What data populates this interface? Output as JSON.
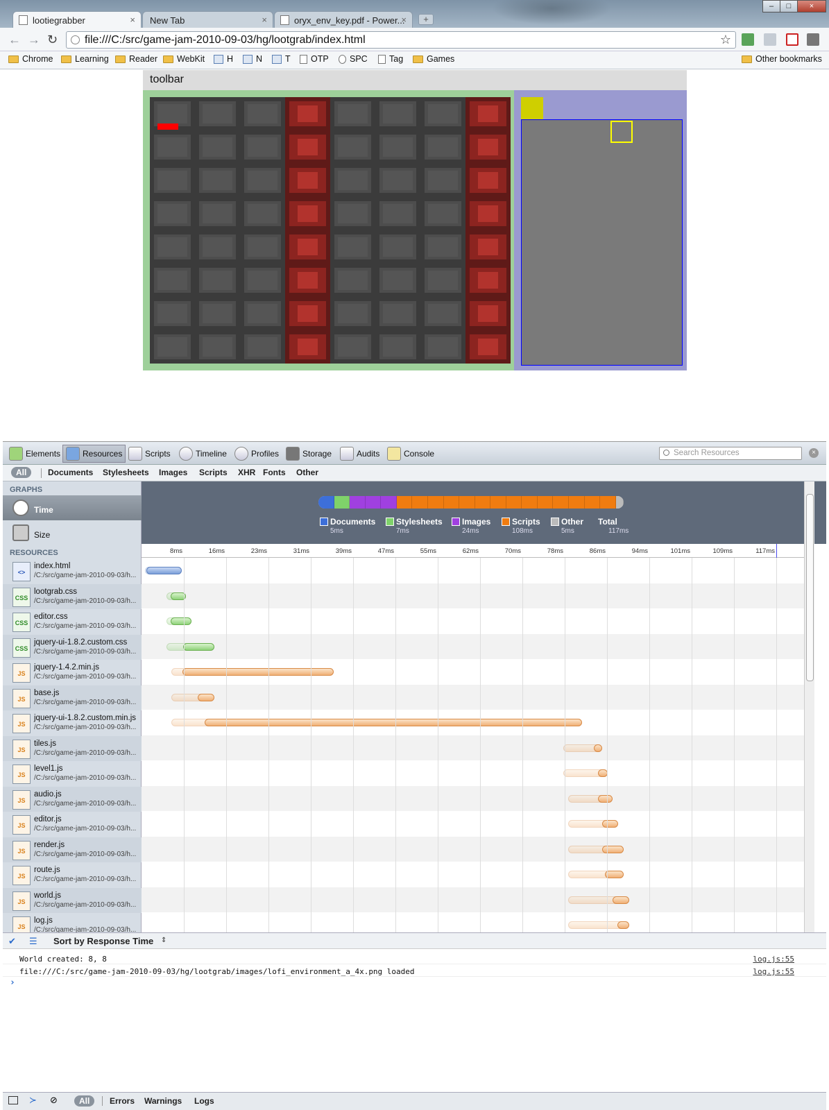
{
  "browser": {
    "tabs": [
      {
        "title": "lootiegrabber",
        "close": "×"
      },
      {
        "title": "New Tab",
        "close": "×"
      },
      {
        "title": "oryx_env_key.pdf - Power...",
        "close": "×"
      }
    ],
    "new_tab": "+",
    "url": "file:///C:/src/game-jam-2010-09-03/hg/lootgrab/index.html",
    "window_controls": {
      "minimize": "–",
      "maximize": "□",
      "close": "×"
    }
  },
  "bookmarks": [
    {
      "label": "Chrome",
      "icon": "folder-icon"
    },
    {
      "label": "Learning",
      "icon": "folder-icon"
    },
    {
      "label": "Reader",
      "icon": "folder-icon"
    },
    {
      "label": "WebKit",
      "icon": "folder-icon"
    },
    {
      "label": "H",
      "icon": "app-icon"
    },
    {
      "label": "N",
      "icon": "app-icon"
    },
    {
      "label": "T",
      "icon": "app-icon"
    },
    {
      "label": "OTP",
      "icon": "page-icon"
    },
    {
      "label": "SPC",
      "icon": "globe-icon"
    },
    {
      "label": "Tag",
      "icon": "page-icon"
    },
    {
      "label": "Games",
      "icon": "folder-icon"
    }
  ],
  "other_bookmarks": "Other bookmarks",
  "game": {
    "toolbar_label": "toolbar",
    "columns": 8,
    "rows": 8,
    "red_columns": [
      3,
      7
    ]
  },
  "devtools": {
    "panels": [
      "Elements",
      "Resources",
      "Scripts",
      "Timeline",
      "Profiles",
      "Storage",
      "Audits",
      "Console"
    ],
    "active_panel": "Resources",
    "search_placeholder": "Search Resources",
    "filters": [
      "All",
      "Documents",
      "Stylesheets",
      "Images",
      "Scripts",
      "XHR",
      "Fonts",
      "Other"
    ],
    "sidebar": {
      "graphs_heading": "GRAPHS",
      "graph_time": "Time",
      "graph_size": "Size",
      "resources_heading": "RESOURCES"
    },
    "summary": [
      {
        "label": "Documents",
        "value": "5ms",
        "color": "#3d6fd9"
      },
      {
        "label": "Stylesheets",
        "value": "7ms",
        "color": "#7fd26a"
      },
      {
        "label": "Images",
        "value": "24ms",
        "color": "#a040e0"
      },
      {
        "label": "Scripts",
        "value": "108ms",
        "color": "#f07c10"
      },
      {
        "label": "Other",
        "value": "5ms",
        "color": "#bbbbbb"
      },
      {
        "label": "Total",
        "value": "117ms",
        "color": ""
      }
    ],
    "ticks": [
      "8ms",
      "16ms",
      "23ms",
      "31ms",
      "39ms",
      "47ms",
      "55ms",
      "62ms",
      "70ms",
      "78ms",
      "86ms",
      "94ms",
      "101ms",
      "109ms",
      "117ms"
    ],
    "resources": [
      {
        "name": "index.html",
        "path": "/C:/src/game-jam-2010-09-03/h...",
        "type": "html",
        "start": 0.3,
        "resp": 0.5,
        "end": 7.0
      },
      {
        "name": "lootgrab.css",
        "path": "/C:/src/game-jam-2010-09-03/h...",
        "type": "css",
        "start": 4.2,
        "resp": 5.0,
        "end": 7.8
      },
      {
        "name": "editor.css",
        "path": "/C:/src/game-jam-2010-09-03/h...",
        "type": "css",
        "start": 4.2,
        "resp": 5.0,
        "end": 8.8
      },
      {
        "name": "jquery-ui-1.8.2.custom.css",
        "path": "/C:/src/game-jam-2010-09-03/h...",
        "type": "css",
        "start": 4.2,
        "resp": 7.3,
        "end": 13.0
      },
      {
        "name": "jquery-1.4.2.min.js",
        "path": "/C:/src/game-jam-2010-09-03/h...",
        "type": "js",
        "start": 5.1,
        "resp": 7.2,
        "end": 35.0
      },
      {
        "name": "base.js",
        "path": "/C:/src/game-jam-2010-09-03/h...",
        "type": "js",
        "start": 5.1,
        "resp": 10.0,
        "end": 13.0
      },
      {
        "name": "jquery-ui-1.8.2.custom.min.js",
        "path": "/C:/src/game-jam-2010-09-03/h...",
        "type": "js",
        "start": 5.1,
        "resp": 11.3,
        "end": 80.8
      },
      {
        "name": "tiles.js",
        "path": "/C:/src/game-jam-2010-09-03/h...",
        "type": "js",
        "start": 77.3,
        "resp": 83.0,
        "end": 84.5
      },
      {
        "name": "level1.js",
        "path": "/C:/src/game-jam-2010-09-03/h...",
        "type": "js",
        "start": 77.3,
        "resp": 83.8,
        "end": 85.5
      },
      {
        "name": "audio.js",
        "path": "/C:/src/game-jam-2010-09-03/h...",
        "type": "js",
        "start": 78.3,
        "resp": 83.8,
        "end": 86.5
      },
      {
        "name": "editor.js",
        "path": "/C:/src/game-jam-2010-09-03/h...",
        "type": "js",
        "start": 78.3,
        "resp": 84.5,
        "end": 87.5
      },
      {
        "name": "render.js",
        "path": "/C:/src/game-jam-2010-09-03/h...",
        "type": "js",
        "start": 78.3,
        "resp": 84.5,
        "end": 88.5
      },
      {
        "name": "route.js",
        "path": "/C:/src/game-jam-2010-09-03/h...",
        "type": "js",
        "start": 78.3,
        "resp": 85.0,
        "end": 88.5
      },
      {
        "name": "world.js",
        "path": "/C:/src/game-jam-2010-09-03/h...",
        "type": "js",
        "start": 78.3,
        "resp": 86.5,
        "end": 89.5
      },
      {
        "name": "log.js",
        "path": "/C:/src/game-jam-2010-09-03/h...",
        "type": "js",
        "start": 78.3,
        "resp": 87.3,
        "end": 89.5
      }
    ],
    "sort_label": "Sort by Response Time",
    "console": [
      {
        "text": "World created: 8, 8",
        "source": "log.js:55"
      },
      {
        "text": "file:///C:/src/game-jam-2010-09-03/hg/lootgrab/images/lofi_environment_a_4x.png loaded",
        "source": "log.js:55"
      }
    ],
    "prompt": "›",
    "console_filters": [
      "All",
      "Errors",
      "Warnings",
      "Logs"
    ]
  }
}
